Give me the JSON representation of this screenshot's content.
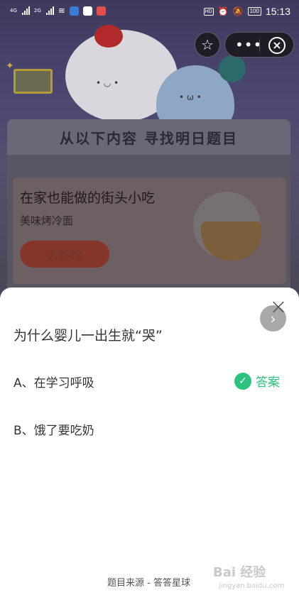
{
  "status_bar": {
    "net1": "4G",
    "net2": "2G",
    "battery": "100",
    "hd": "HD",
    "time": "15:13"
  },
  "background": {
    "banner_title": "从以下内容 寻找明日题目",
    "card_title": "在家也能做的街头小吃",
    "card_subtitle": "美味烤冷面",
    "card_button": "去解馋"
  },
  "capsule": {
    "favorite_icon": "star-icon",
    "more_icon": "more-dots-icon",
    "close_icon": "circle-close-icon"
  },
  "sheet": {
    "question": "为什么婴儿一出生就“哭”",
    "options": [
      {
        "label": "A、在学习呼吸",
        "is_answer": true
      },
      {
        "label": "B、饿了要吃奶",
        "is_answer": false
      }
    ],
    "answer_label": "答案",
    "source": "题目来源 - 答答星球",
    "accent_color": "#2ec27e"
  },
  "watermark": {
    "text": "Bai 经验",
    "url": "jingyan.baidu.com"
  }
}
